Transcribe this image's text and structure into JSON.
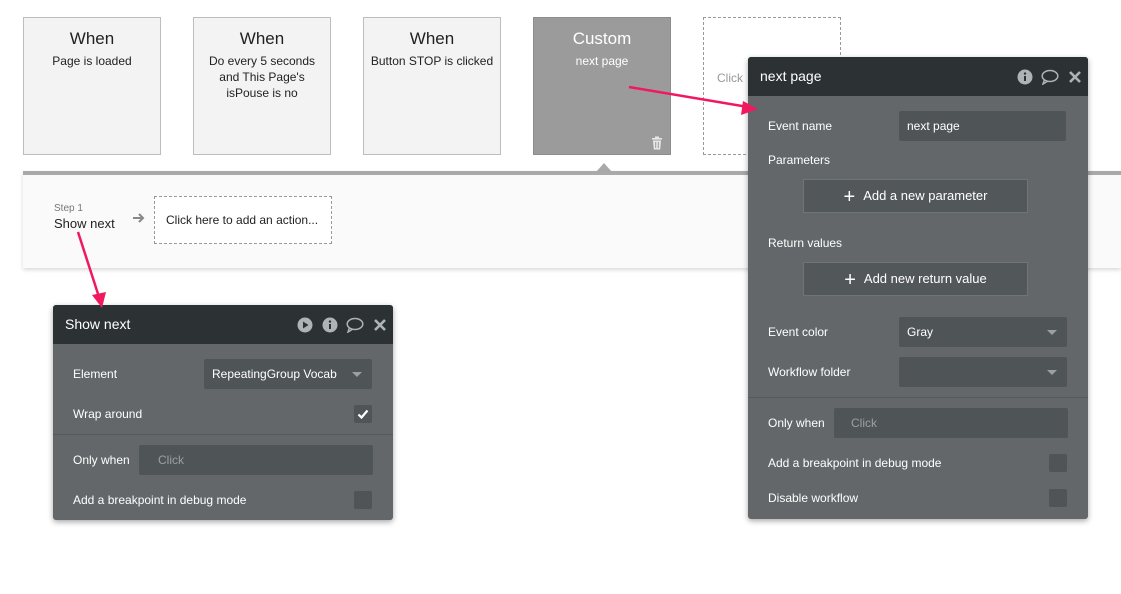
{
  "events": [
    {
      "title": "When",
      "desc": "Page is loaded"
    },
    {
      "title": "When",
      "desc": "Do every 5 seconds and This Page's isPouse is no"
    },
    {
      "title": "When",
      "desc": "Button STOP is clicked"
    },
    {
      "title": "Custom",
      "desc": "next page"
    },
    {
      "desc": "Click"
    }
  ],
  "workflow": {
    "step_label": "Step 1",
    "step_name": "Show next",
    "add_action": "Click here to add an action..."
  },
  "action_panel": {
    "title": "Show next",
    "element_label": "Element",
    "element_value": "RepeatingGroup Vocab",
    "wrap_label": "Wrap around",
    "wrap_checked": true,
    "only_when_label": "Only when",
    "only_when_placeholder": "Click",
    "breakpoint_label": "Add a breakpoint in debug mode"
  },
  "event_panel": {
    "title": "next page",
    "event_name_label": "Event name",
    "event_name_value": "next page",
    "parameters_label": "Parameters",
    "add_param_button": "Add a new parameter",
    "return_values_label": "Return values",
    "add_return_button": "Add new return value",
    "event_color_label": "Event color",
    "event_color_value": "Gray",
    "folder_label": "Workflow folder",
    "folder_value": "",
    "only_when_label": "Only when",
    "only_when_placeholder": "Click",
    "breakpoint_label": "Add a breakpoint in debug mode",
    "disable_label": "Disable workflow"
  },
  "colors": {
    "accent_arrow": "#f0195f",
    "panel_bg": "#636769",
    "panel_header": "#2c3134",
    "custom_event": "#9b9b9b"
  }
}
